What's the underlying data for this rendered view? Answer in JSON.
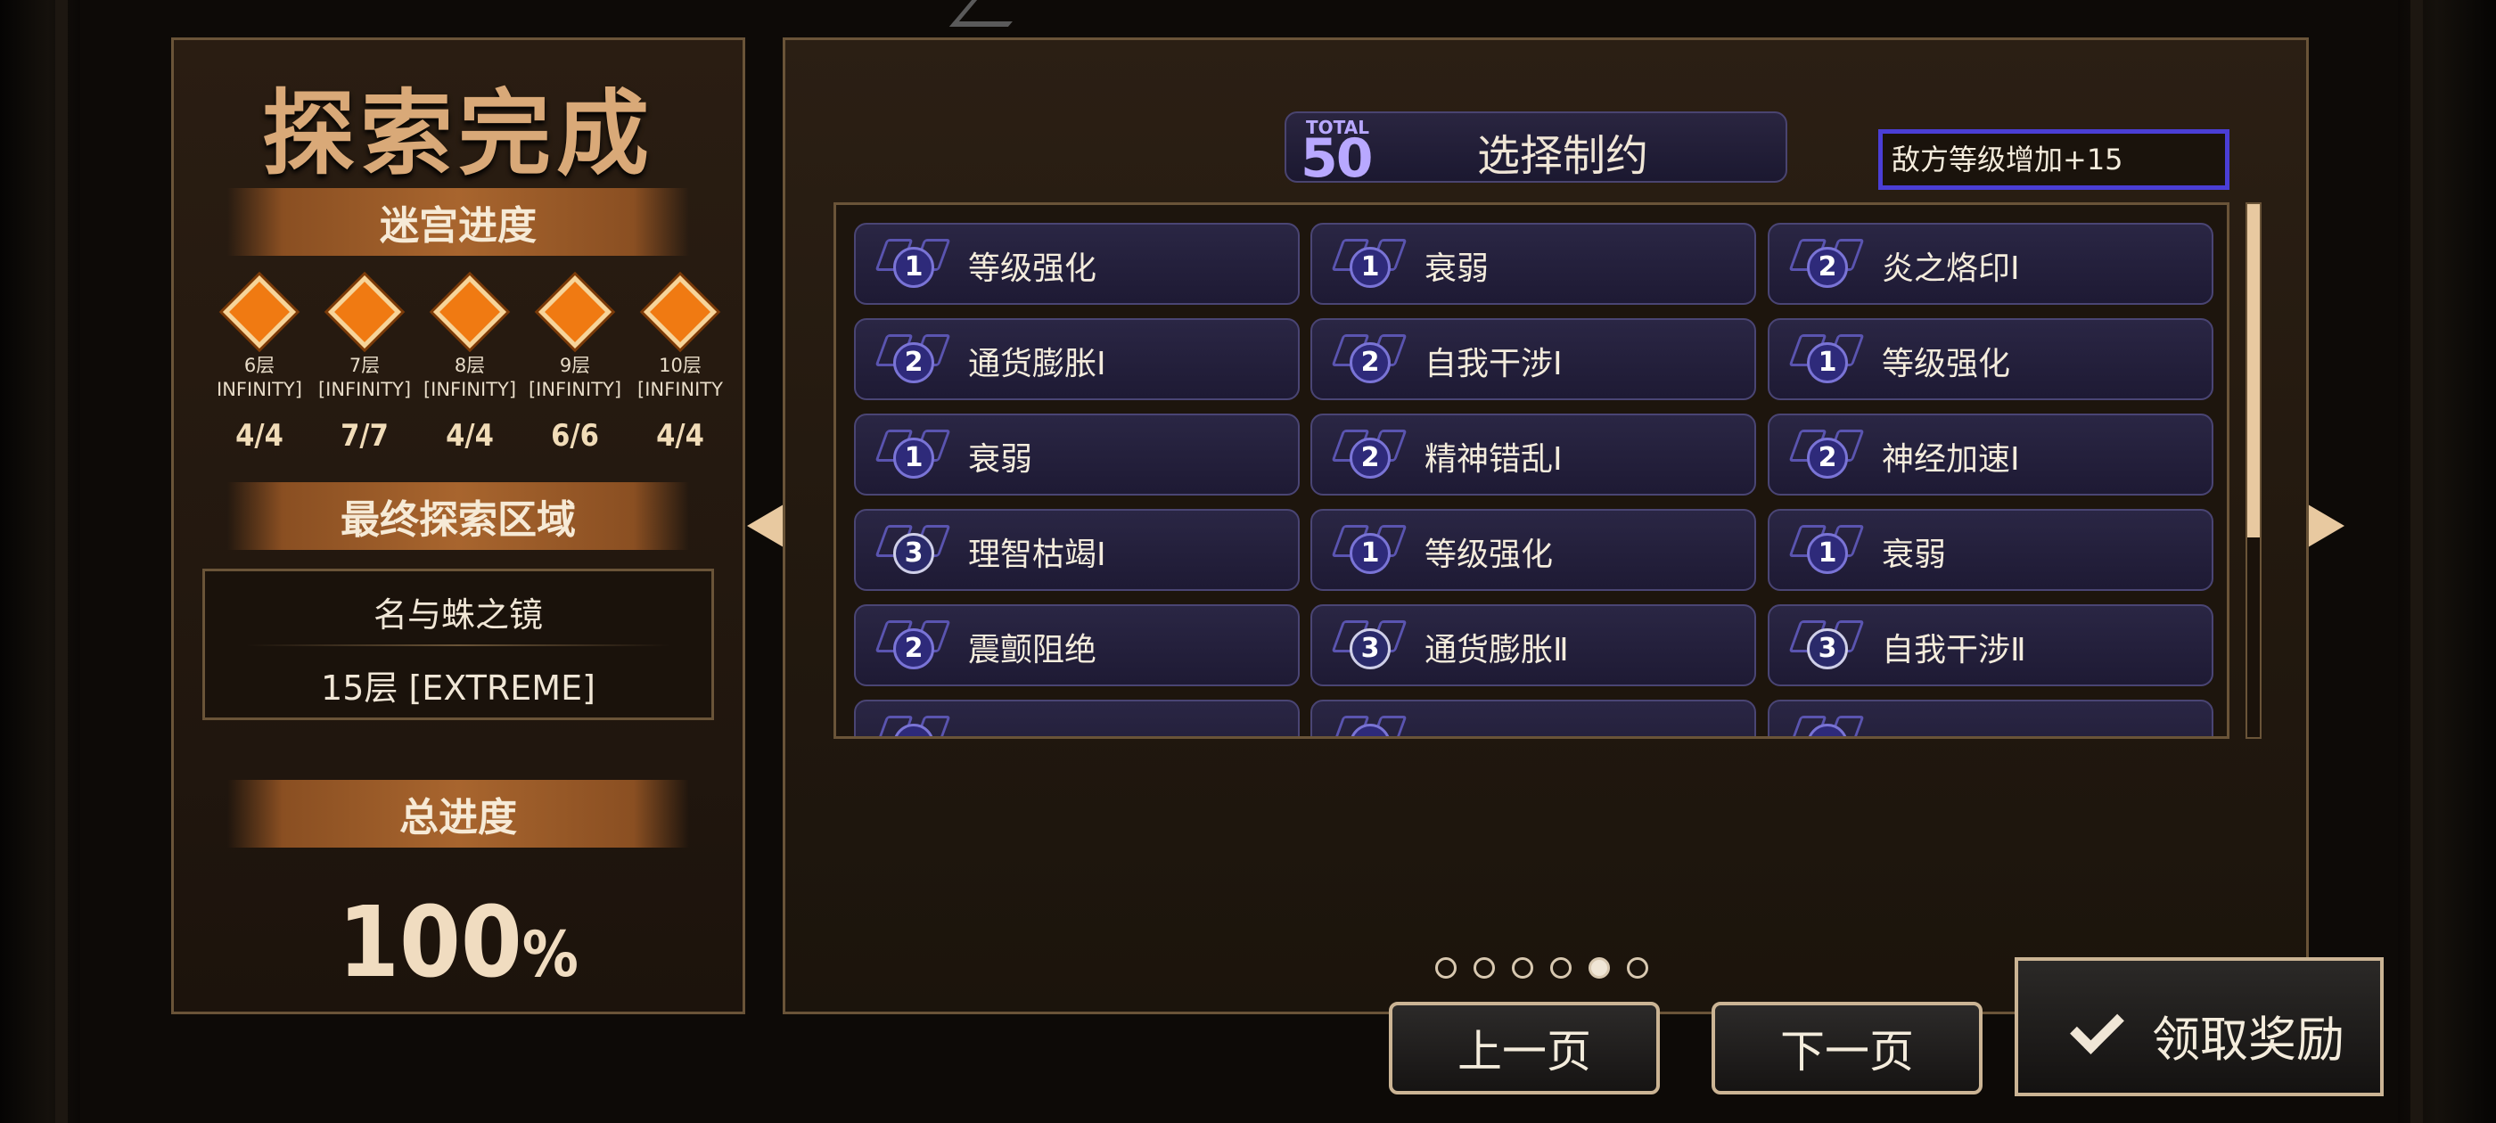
{
  "left": {
    "title": "探索完成",
    "maze_progress_label": "迷宫进度",
    "floors": [
      {
        "name": "6层",
        "mode": "INFINITY]",
        "progress": "4/4"
      },
      {
        "name": "7层",
        "mode": "[INFINITY]",
        "progress": "7/7"
      },
      {
        "name": "8层",
        "mode": "[INFINITY]",
        "progress": "4/4"
      },
      {
        "name": "9层",
        "mode": "[INFINITY]",
        "progress": "6/6"
      },
      {
        "name": "10层",
        "mode": "[INFINITY",
        "progress": "4/4"
      }
    ],
    "final_area_label": "最终探索区域",
    "final_area_name": "名与蛛之镜",
    "final_area_floor": "15层 [EXTREME]",
    "total_label": "总进度",
    "total_value": "100",
    "total_unit": "%"
  },
  "header": {
    "total_label": "TOTAL",
    "total_value": "50",
    "title": "选择制约",
    "enemy_level": "敌方等级增加+15"
  },
  "constraints": [
    {
      "level": "1",
      "label": "等级强化"
    },
    {
      "level": "1",
      "label": "衰弱"
    },
    {
      "level": "2",
      "label": "炎之烙印Ⅰ"
    },
    {
      "level": "2",
      "label": "通货膨胀Ⅰ"
    },
    {
      "level": "2",
      "label": "自我干涉Ⅰ"
    },
    {
      "level": "1",
      "label": "等级强化"
    },
    {
      "level": "1",
      "label": "衰弱"
    },
    {
      "level": "2",
      "label": "精神错乱Ⅰ"
    },
    {
      "level": "2",
      "label": "神经加速Ⅰ"
    },
    {
      "level": "3",
      "label": "理智枯竭Ⅰ"
    },
    {
      "level": "1",
      "label": "等级强化"
    },
    {
      "level": "1",
      "label": "衰弱"
    },
    {
      "level": "2",
      "label": "震颤阻绝"
    },
    {
      "level": "3",
      "label": "通货膨胀Ⅱ"
    },
    {
      "level": "3",
      "label": "自我干涉Ⅱ"
    },
    {
      "level": "",
      "label": ""
    },
    {
      "level": "",
      "label": ""
    },
    {
      "level": "",
      "label": ""
    }
  ],
  "pagination": {
    "pages": 6,
    "active": 5
  },
  "buttons": {
    "prev": "上一页",
    "next": "下一页",
    "claim": "领取奖励"
  },
  "colors": {
    "accent_purple": "#4a3ed6",
    "badge_purple": "#2e2a7a",
    "diamond_orange": "#f07a12",
    "panel_border": "#6a5438"
  }
}
